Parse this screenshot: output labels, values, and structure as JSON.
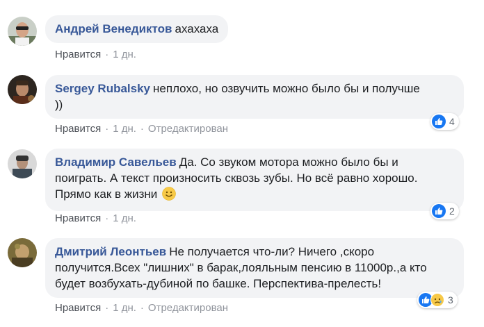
{
  "comments": [
    {
      "author": "Андрей Венедиктов",
      "text": "ахахаха",
      "like_label": "Нравится",
      "time": "1 дн.",
      "edited": ""
    },
    {
      "author": "Sergey Rubalsky",
      "text_line1": "неплохо, но озвучить можно было бы и получше",
      "text_line2": "))",
      "like_label": "Нравится",
      "time": "1 дн.",
      "edited": "Отредактирован",
      "reaction_count": "4",
      "reactions": [
        "like"
      ]
    },
    {
      "author": "Владимир Савельев",
      "text_line1": "Да. Со звуком мотора можно было бы и",
      "text_line2": "поиграть. А текст произносить сквозь зубы. Но всё равно хорошо.",
      "text_line3": "Прямо как в жизни",
      "emoji": "smile",
      "like_label": "Нравится",
      "time": "1 дн.",
      "edited": "",
      "reaction_count": "2",
      "reactions": [
        "like"
      ]
    },
    {
      "author": "Дмитрий Леонтьев",
      "text_line1": "Не получается что-ли? Ничего ,скоро",
      "text_line2": "получится.Всех \"лишних\" в барак,лояльным пенсию в 11000р.,а кто",
      "text_line3": "будет возбухать-дубиной по башке. Перспектива-прелесть!",
      "like_label": "Нравится",
      "time": "1 дн.",
      "edited": "Отредактирован",
      "reaction_count": "3",
      "reactions": [
        "like",
        "sad"
      ]
    }
  ],
  "colors": {
    "author": "#385898",
    "bubble": "#f2f3f5",
    "meta": "#90949c",
    "like_blue": "#1877f2",
    "sad_yellow": "#f7c948"
  }
}
